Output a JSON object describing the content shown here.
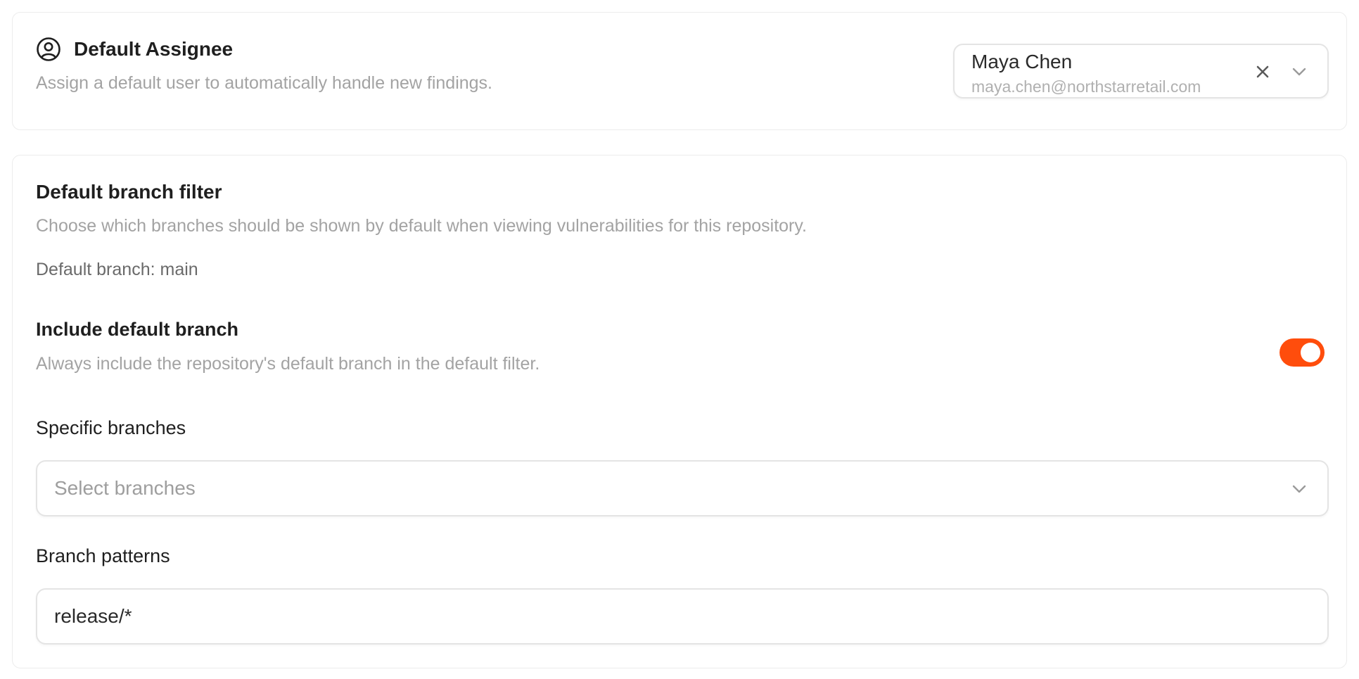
{
  "assignee": {
    "title": "Default Assignee",
    "description": "Assign a default user to automatically handle new findings.",
    "selected_name": "Maya Chen",
    "selected_email": "maya.chen@northstarretail.com",
    "icons": {
      "section": "user-circle-icon",
      "clear": "close-icon",
      "expand": "chevron-down-icon"
    }
  },
  "branch_filter": {
    "title": "Default branch filter",
    "description": "Choose which branches should be shown by default when viewing vulnerabilities for this repository.",
    "default_branch_text": "Default branch: main",
    "include_default": {
      "title": "Include default branch",
      "description": "Always include the repository's default branch in the default filter.",
      "enabled": true
    },
    "specific_branches": {
      "label": "Specific branches",
      "placeholder": "Select branches"
    },
    "branch_patterns": {
      "label": "Branch patterns",
      "value": "release/*"
    }
  },
  "colors": {
    "accent": "#ff4d0c",
    "muted_text": "#a3a3a3",
    "border": "#e4e4e4"
  }
}
